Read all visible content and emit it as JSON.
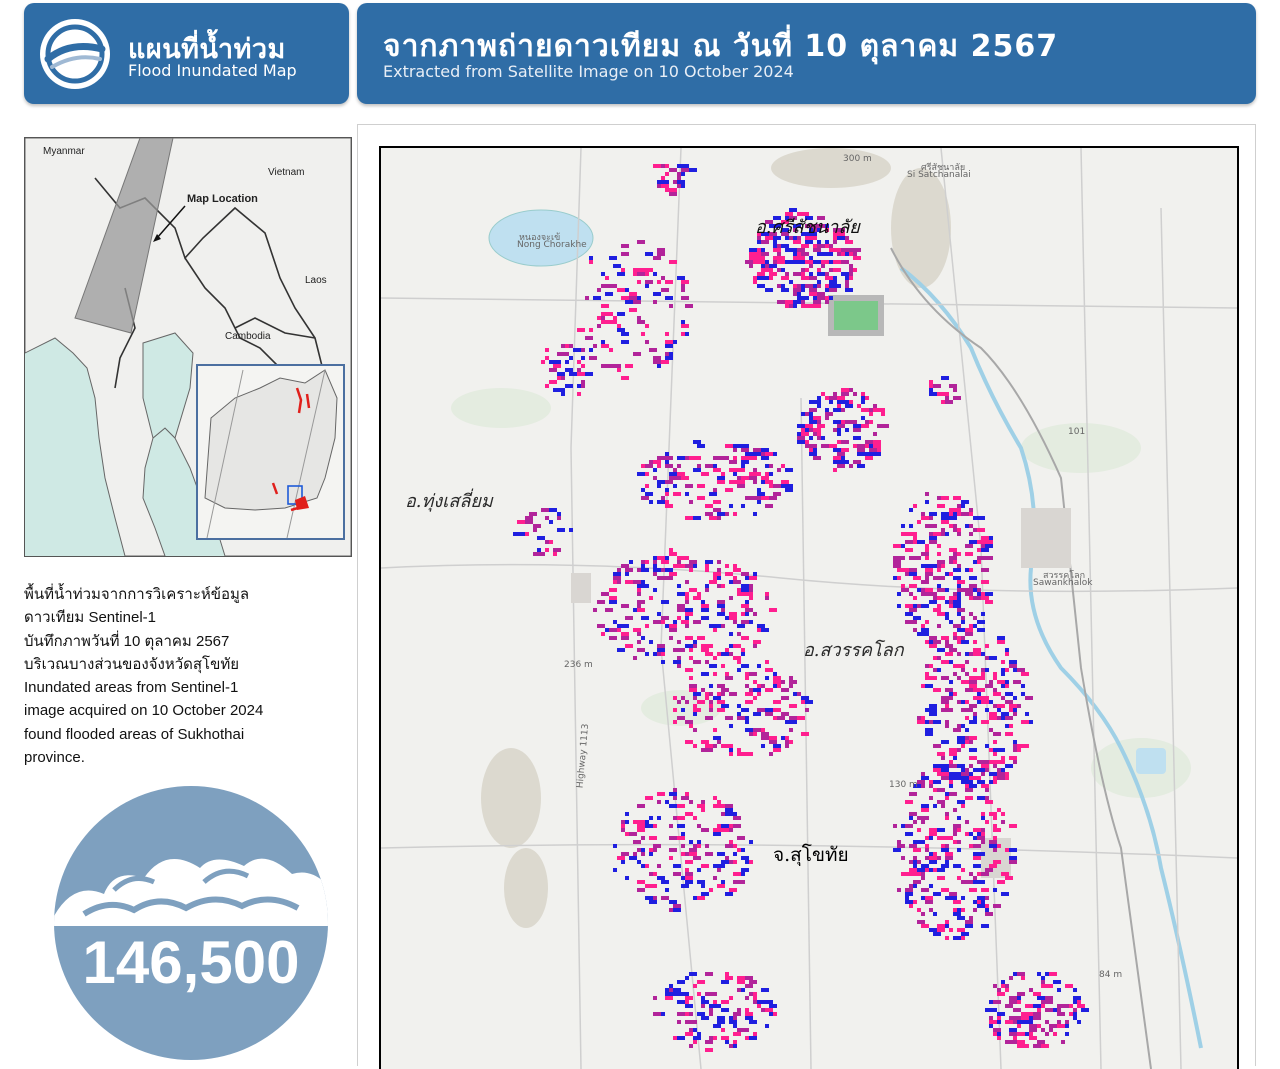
{
  "header": {
    "logo_th": "แผนที่น้ำท่วม",
    "logo_en": "Flood Inundated Map",
    "title_th": "จากภาพถ่ายดาวเทียม ณ วันที่ 10 ตุลาคม 2567",
    "title_en": "Extracted from Satellite Image on 10 October 2024"
  },
  "locator_map": {
    "labels": {
      "myanmar": "Myanmar",
      "vietnam": "Vietnam",
      "map_location": "Map Location",
      "laos": "Laos",
      "cambodia": "Cambodia"
    }
  },
  "description_lines": [
    "พื้นที่น้ำท่วมจากการวิเคราะห์ข้อมูล",
    "ดาวเทียม Sentinel-1",
    "บันทึกภาพวันที่ 10 ตุลาคม 2567",
    "บริเวณบางส่วนของจังหวัดสุโขทัย",
    "Inundated areas from Sentinel-1",
    "image acquired on 10 October 2024",
    "found flooded areas of Sukhothai",
    "province."
  ],
  "stat": {
    "value": "146,500",
    "icon": "wave-icon"
  },
  "map": {
    "places": {
      "si_satchanalai_district": "อ.ศรีสัชนาลัย",
      "thung_saliam_district": "อ.ทุ่งเสลี่ยม",
      "sawankhalok_district": "อ.สวรรคโลก",
      "sukhothai_province": "จ.สุโขทัย",
      "nong_chorakhe_th": "หนองจะเข้",
      "nong_chorakhe_en": "Nong Chorakhe",
      "si_satchanalai_th": "ศรีสัชนาลัย",
      "si_satchanalai_en": "Si Satchanalai",
      "sawankhalok_th": "สวรรคโลก",
      "sawankhalok_en": "Sawankhalok",
      "elev_300": "300 m",
      "elev_236": "236 m",
      "elev_130": "130 m",
      "elev_84": "84 m",
      "road_101": "101",
      "road_1113": "Highway 1113"
    },
    "legend_colors": {
      "flood_high": "#ff1f8f",
      "flood_low": "#1f1fe0",
      "flood_mid": "#b2249a"
    }
  }
}
